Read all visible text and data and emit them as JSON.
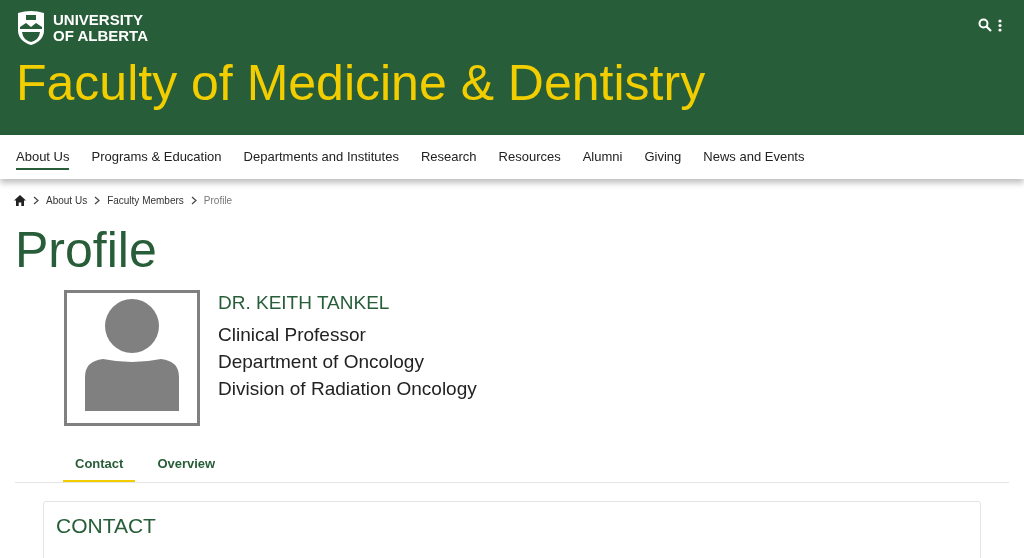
{
  "header": {
    "logo_lines": [
      "UNIVERSITY",
      "OF ALBERTA"
    ],
    "title": "Faculty of Medicine & Dentistry"
  },
  "nav": [
    {
      "label": "About Us",
      "selected": true
    },
    {
      "label": "Programs & Education",
      "selected": false
    },
    {
      "label": "Departments and Institutes",
      "selected": false
    },
    {
      "label": "Research",
      "selected": false
    },
    {
      "label": "Resources",
      "selected": false
    },
    {
      "label": "Alumni",
      "selected": false
    },
    {
      "label": "Giving",
      "selected": false
    },
    {
      "label": "News and Events",
      "selected": false
    }
  ],
  "breadcrumb": [
    {
      "label": "About Us",
      "current": false
    },
    {
      "label": "Faculty Members",
      "current": false
    },
    {
      "label": "Profile",
      "current": true
    }
  ],
  "page_title": "Profile",
  "profile": {
    "name": "DR. KEITH TANKEL",
    "lines": [
      "Clinical Professor",
      "Department of Oncology",
      "Division of Radiation Oncology"
    ]
  },
  "tabs": [
    {
      "label": "Contact",
      "selected": true
    },
    {
      "label": "Overview",
      "selected": false
    }
  ],
  "section": {
    "heading": "CONTACT"
  }
}
